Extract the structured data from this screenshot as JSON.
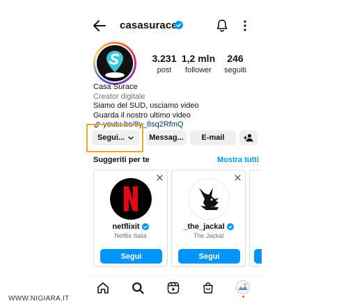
{
  "header": {
    "username": "casasurace",
    "verified": true
  },
  "profile": {
    "stats": [
      {
        "value": "3.231",
        "label": "post"
      },
      {
        "value": "1,2 mln",
        "label": "follower"
      },
      {
        "value": "246",
        "label": "seguiti"
      }
    ],
    "name": "Casa Surace",
    "category": "Creator digitale",
    "bio_lines": [
      "Siamo del SUD, usciamo video",
      "Guarda il nostro ultimo video"
    ],
    "link": "youtu.be/8y_8sq2RfmQ"
  },
  "actions": {
    "follow_label": "Segui...",
    "message_label": "Messag...",
    "email_label": "E-mail"
  },
  "suggested": {
    "title": "Suggeriti per te",
    "see_all": "Mostra tutti",
    "cards": [
      {
        "username": "netflixit",
        "full_name": "Netflix Italia",
        "button": "Segui"
      },
      {
        "username": "_the_jackal",
        "full_name": "The Jackal",
        "button": "Segui"
      }
    ]
  },
  "colors": {
    "accent": "#0095f6",
    "highlight": "#f5a623",
    "netflix_red": "#e50914"
  },
  "watermark": "WWW.NIGIARA.IT"
}
